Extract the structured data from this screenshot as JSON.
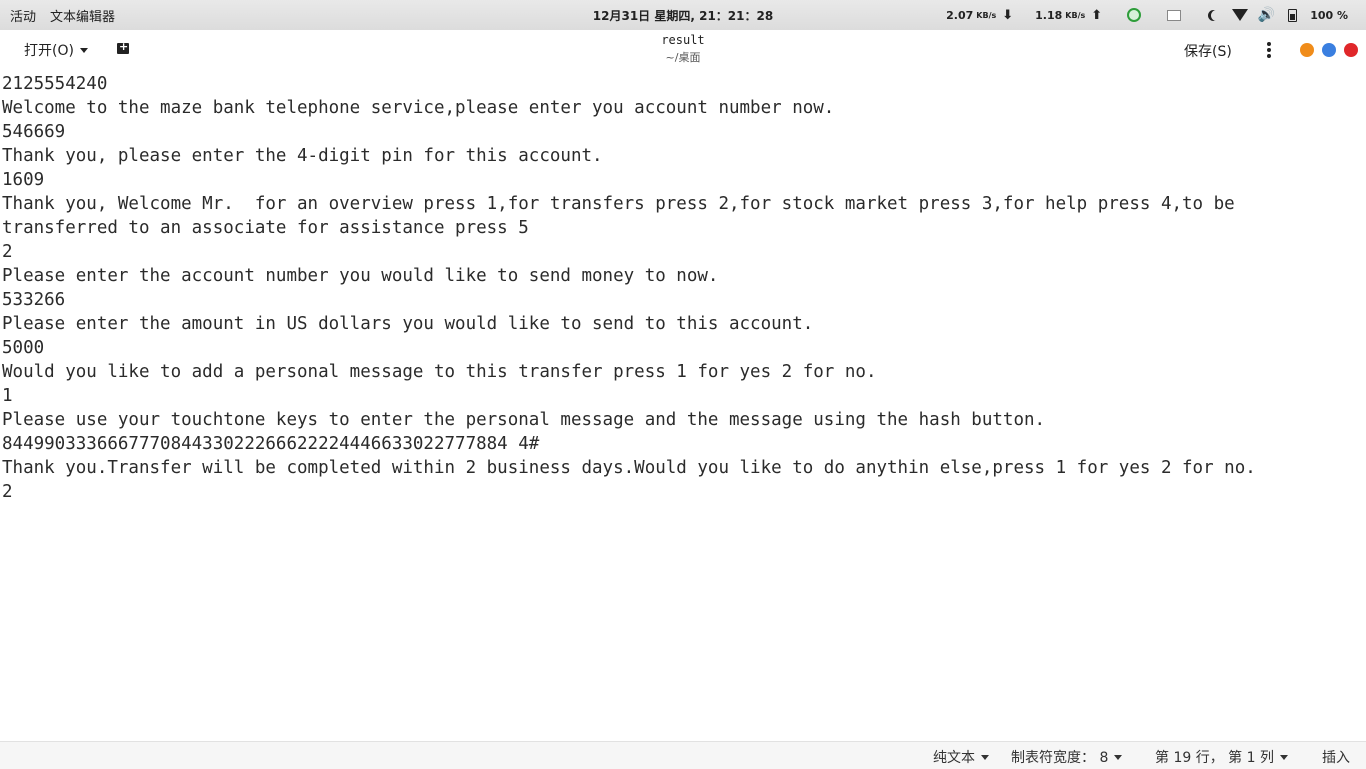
{
  "topbar": {
    "activities": "活动",
    "app_name": "文本编辑器",
    "clock": "12月31日 星期四, 21：21：28",
    "download_speed": "2.07",
    "download_unit": "KB/s",
    "upload_speed": "1.18",
    "upload_unit": "KB/s",
    "battery": "100 %"
  },
  "header": {
    "open_label": "打开(O)",
    "title": "result",
    "subtitle": "~/桌面",
    "save_label": "保存(S)",
    "window_button_colors": [
      "#f08c1a",
      "#3a7fe0",
      "#e0272a"
    ]
  },
  "editor": {
    "lines": [
      "2125554240",
      "Welcome to the maze bank telephone service,please enter you account number now.",
      "546669",
      "Thank you, please enter the 4-digit pin for this account.",
      "1609",
      "Thank you, Welcome Mr.  for an overview press 1,for transfers press 2,for stock market press 3,for help press 4,to be",
      "transferred to an associate for assistance press 5",
      "2",
      "Please enter the account number you would like to send money to now.",
      "533266",
      "Please enter the amount in US dollars you would like to send to this account.",
      "5000",
      "Would you like to add a personal message to this transfer press 1 for yes 2 for no.",
      "1",
      "Please use your touchtone keys to enter the personal message and the message using the hash button.",
      "844990333666777084433022266622224446633022777884 4#",
      "Thank you.Transfer will be completed within 2 business days.Would you like to do anythin else,press 1 for yes 2 for no.",
      "2"
    ]
  },
  "statusbar": {
    "syntax": "纯文本",
    "tab_width": "制表符宽度： 8",
    "position": "第 19 行， 第 1 列",
    "mode": "插入"
  }
}
